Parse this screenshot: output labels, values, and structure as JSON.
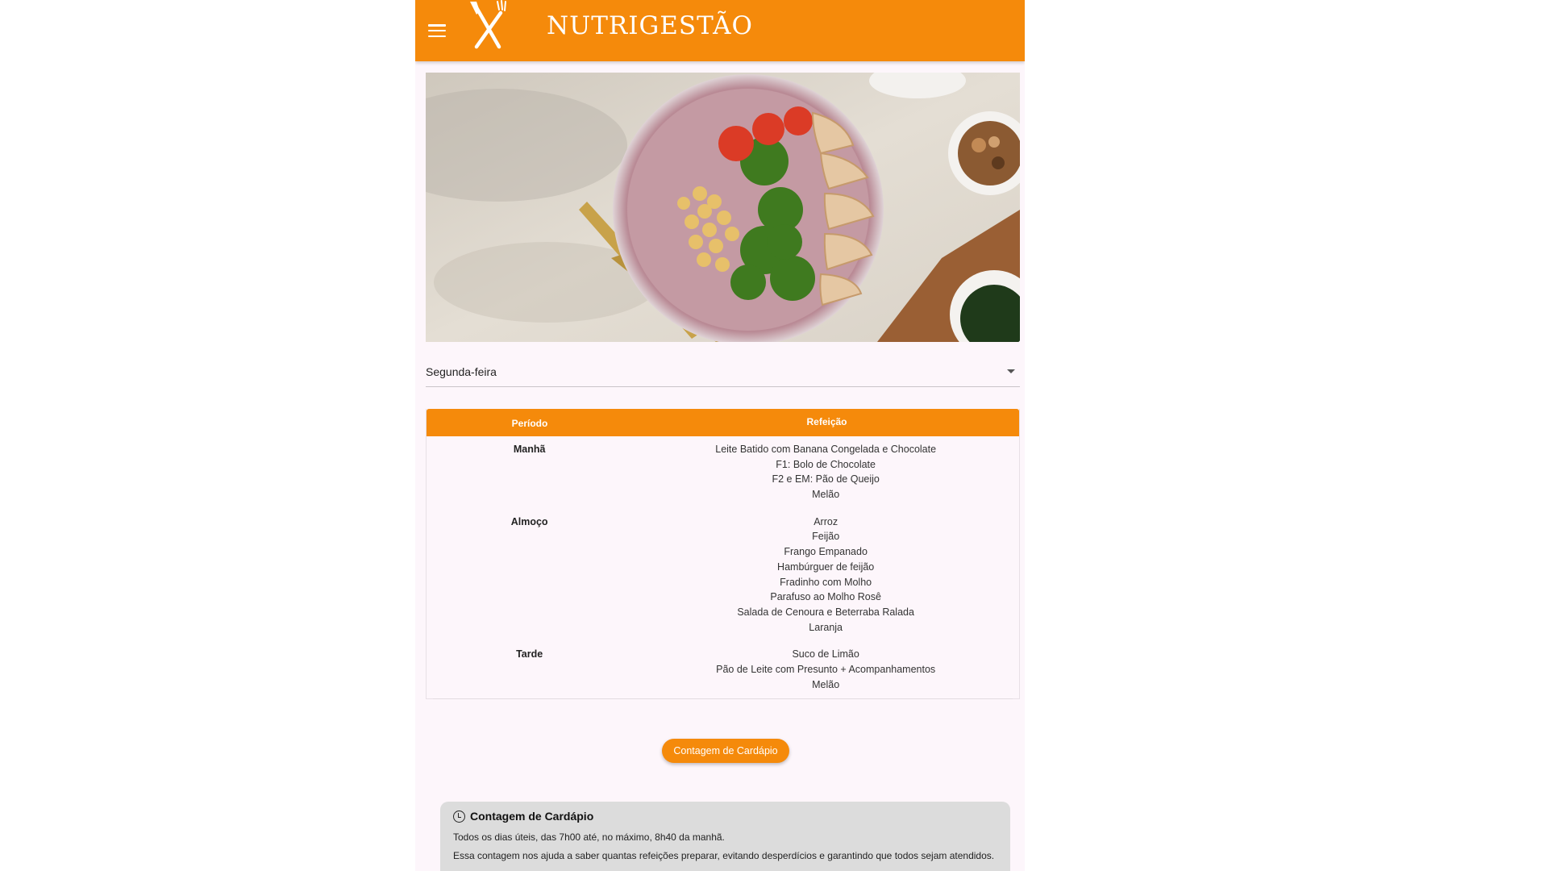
{
  "app": {
    "title": "NUTRIGESTÃO",
    "accent_color": "#f58a0b"
  },
  "header": {
    "menu_icon": "hamburger-menu-icon",
    "logo_icon": "fork-knife-icon"
  },
  "hero": {
    "image": "plate-with-chicken-broccoli-chickpeas-tomatoes"
  },
  "day_selector": {
    "selected": "Segunda-feira",
    "icon": "dropdown-caret-icon"
  },
  "menu_table": {
    "headers": {
      "period": "Período",
      "meal": "Refeição"
    },
    "rows": [
      {
        "period": "Manhã",
        "items": [
          "Leite Batido com Banana Congelada e Chocolate",
          "F1: Bolo de Chocolate",
          "F2 e EM: Pão de Queijo",
          "Melão"
        ]
      },
      {
        "period": "Almoço",
        "items": [
          "Arroz",
          "Feijão",
          "Frango Empanado",
          "Hambúrguer de feijão",
          "Fradinho com Molho",
          "Parafuso ao Molho Rosê",
          "Salada de Cenoura e Beterraba Ralada",
          "Laranja"
        ]
      },
      {
        "period": "Tarde",
        "items": [
          "Suco de Limão",
          "Pão de Leite com Presunto + Acompanhamentos",
          "Melão"
        ]
      }
    ]
  },
  "cta": {
    "label": "Contagem de Cardápio"
  },
  "info_card": {
    "icon": "clock-icon",
    "title": "Contagem de Cardápio",
    "line1": "Todos os dias úteis, das 7h00 até, no máximo, 8h40 da manhã.",
    "line2": "Essa contagem nos ajuda a saber quantas refeições preparar, evitando desperdícios e garantindo que todos sejam atendidos."
  }
}
